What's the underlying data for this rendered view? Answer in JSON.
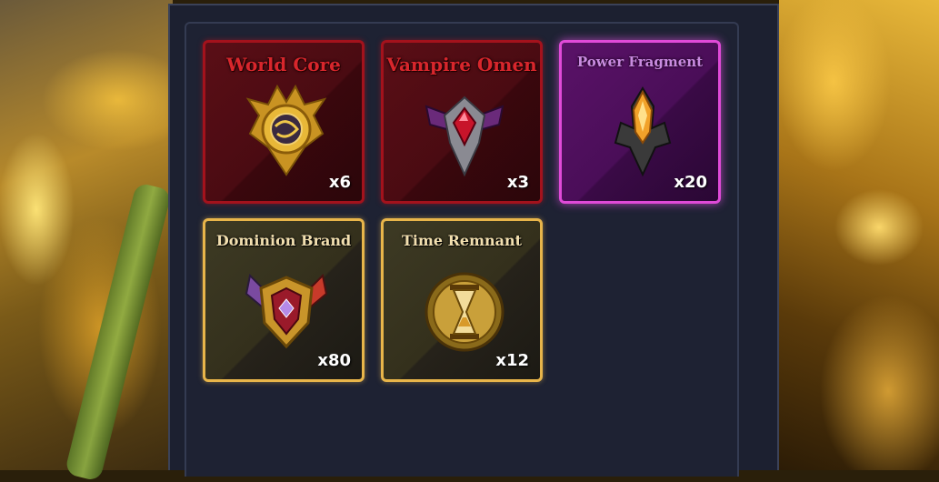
{
  "inventory": {
    "items": [
      {
        "name": "World Core",
        "count": "x6",
        "rarity": "red",
        "icon": "golden-orb-emblem"
      },
      {
        "name": "Vampire Omen",
        "count": "x3",
        "rarity": "red",
        "icon": "ruby-winged-emblem"
      },
      {
        "name": "Power Fragment",
        "count": "x20",
        "rarity": "purple",
        "icon": "flame-crest-emblem"
      },
      {
        "name": "Dominion Brand",
        "count": "x80",
        "rarity": "gold",
        "icon": "shield-gem-emblem"
      },
      {
        "name": "Time Remnant",
        "count": "x12",
        "rarity": "gold",
        "icon": "hourglass-emblem"
      }
    ]
  },
  "colors": {
    "panel_bg": "#1c2030",
    "red_border": "#a3121c",
    "purple_border": "#e04ad8",
    "gold_border": "#e8b54a"
  }
}
